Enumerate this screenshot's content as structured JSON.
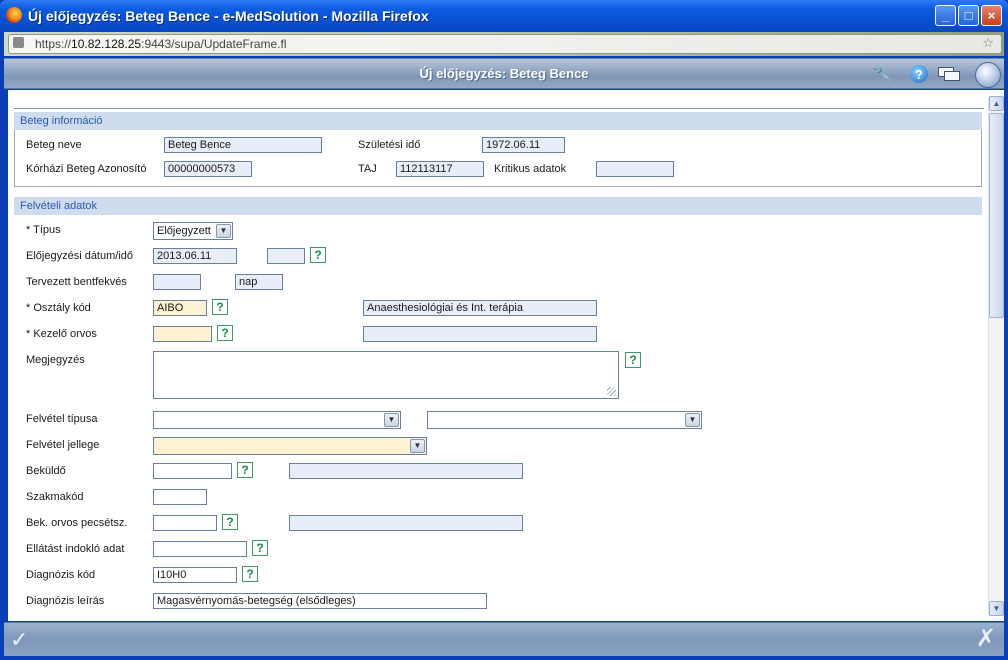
{
  "window": {
    "title": "Új előjegyzés: Beteg Bence - e-MedSolution - Mozilla Firefox"
  },
  "url": {
    "prefix": "https://",
    "host": "10.82.128.25",
    "rest": ":9443/supa/UpdateFrame.fl"
  },
  "app": {
    "title": "Új előjegyzés: Beteg Bence"
  },
  "patient_section": {
    "header": "Beteg információ",
    "name_label": "Beteg neve",
    "name_value": "Beteg Bence",
    "birth_label": "Születési idő",
    "birth_value": "1972.06.11",
    "hospital_id_label": "Kórházi Beteg Azonosító",
    "hospital_id_value": "00000000573",
    "taj_label": "TAJ",
    "taj_value": "112113117",
    "critical_label": "Kritikus adatok",
    "critical_value": ""
  },
  "admission_section": {
    "header": "Felvételi adatok",
    "type_label": "* Típus",
    "type_value": "Előjegyzett",
    "date_label": "Előjegyzési dátum/idő",
    "date_value": "2013.06.11",
    "time_value": "",
    "planned_label": "Tervezett bentfekvés",
    "planned_value": "",
    "planned_unit": "nap",
    "dept_label": "* Osztály kód",
    "dept_value": "AIBO",
    "dept_desc": "Anaesthesiológiai és Int. terápia",
    "doctor_label": "* Kezelő orvos",
    "doctor_value": "",
    "doctor_desc": "",
    "note_label": "Megjegyzés",
    "admission_type_label": "Felvétel típusa",
    "admission_type_value": "",
    "admission_type_value2": "",
    "admission_nature_label": "Felvétel jellege",
    "admission_nature_value": "",
    "referrer_label": "Beküldő",
    "referrer_value": "",
    "referrer_desc": "",
    "specialty_label": "Szakmakód",
    "specialty_value": "",
    "ref_doctor_label": "Bek. orvos pecsétsz.",
    "ref_doctor_value": "",
    "ref_doctor_desc": "",
    "justify_label": "Ellátást indokló adat",
    "justify_value": "",
    "diag_code_label": "Diagnózis kód",
    "diag_code_value": "I10H0",
    "diag_desc_label": "Diagnózis leírás",
    "diag_desc_value": "Magasvérnyomás-betegség (elsődleges)"
  },
  "help_glyph": "?",
  "buttons": {
    "ok": "✓",
    "cancel": "✗"
  }
}
